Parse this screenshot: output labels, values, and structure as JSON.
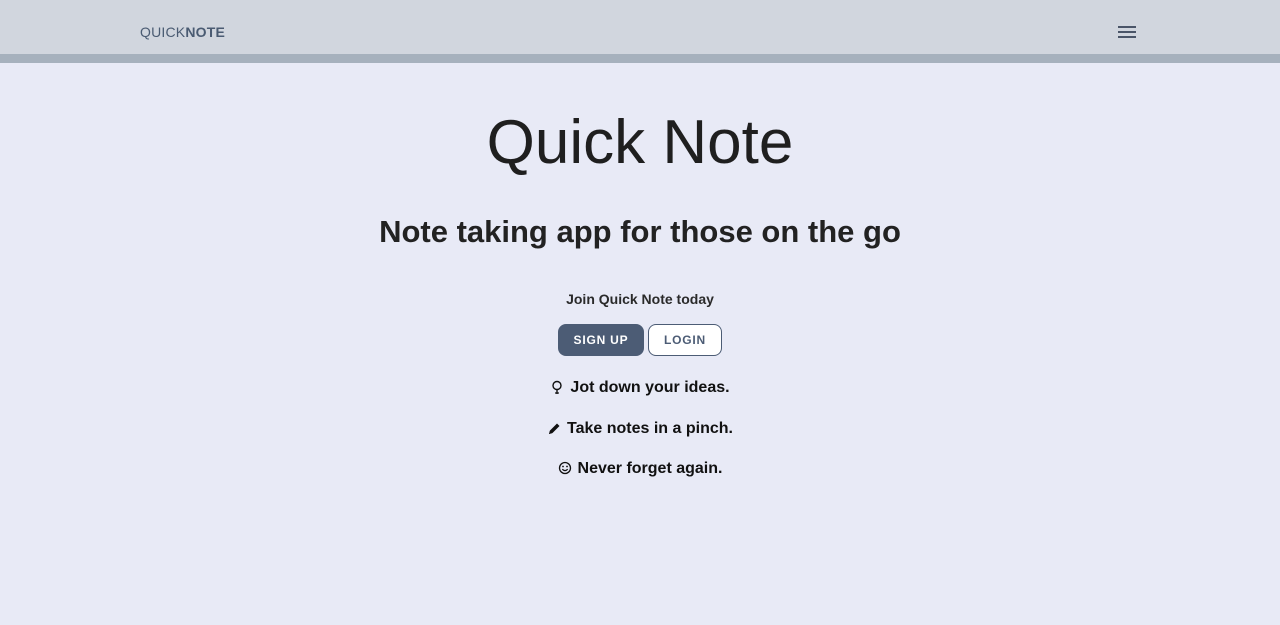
{
  "header": {
    "brand_light": "QUICK",
    "brand_bold": "NOTE",
    "menu_icon": "hamburger-menu-icon"
  },
  "hero": {
    "title": "Quick Note",
    "subtitle": "Note taking app for those on the go",
    "join_text": "Join Quick Note today"
  },
  "actions": {
    "signup_label": "SIGN UP",
    "login_label": "LOGIN"
  },
  "features": [
    {
      "icon": "lightbulb-icon",
      "text": "Jot down your ideas."
    },
    {
      "icon": "pencil-icon",
      "text": "Take notes in a pinch."
    },
    {
      "icon": "smiley-icon",
      "text": "Never forget again."
    }
  ],
  "colors": {
    "background": "#e8eaf6",
    "topbar": "#d1d6de",
    "topbar_stripe": "#a6b1bd",
    "primary": "#4c5c75"
  }
}
